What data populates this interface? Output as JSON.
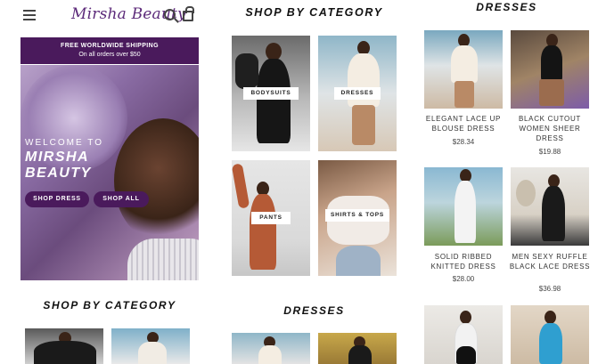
{
  "header": {
    "logo": "Mirsha Beauty"
  },
  "shipping": {
    "line1": "FREE WORLDWIDE SHIPPING",
    "line2": "On all orders over $50"
  },
  "hero": {
    "welcome": "WELCOME TO",
    "brand": "MIRSHA BEAUTY",
    "shop_dress": "SHOP DRESS",
    "shop_all": "SHOP ALL"
  },
  "column1": {
    "section_title": "SHOP BY CATEGORY"
  },
  "column2": {
    "section_title": "SHOP BY CATEGORY",
    "categories": [
      {
        "label": "BODYSUITS"
      },
      {
        "label": "DRESSES"
      },
      {
        "label": "PANTS"
      },
      {
        "label": "SHIRTS & TOPS"
      }
    ],
    "dresses_title": "DRESSES"
  },
  "column3": {
    "section_title": "DRESSES",
    "products": [
      {
        "name": "ELEGANT LACE UP BLOUSE DRESS",
        "price": "$28.34"
      },
      {
        "name": "BLACK CUTOUT WOMEN SHEER DRESS",
        "price": "$19.88"
      },
      {
        "name": "SOLID RIBBED KNITTED DRESS",
        "price": "$28.00"
      },
      {
        "name": "MEN SEXY RUFFLE BLACK LACE DRESS",
        "price": "$36.98"
      }
    ]
  }
}
